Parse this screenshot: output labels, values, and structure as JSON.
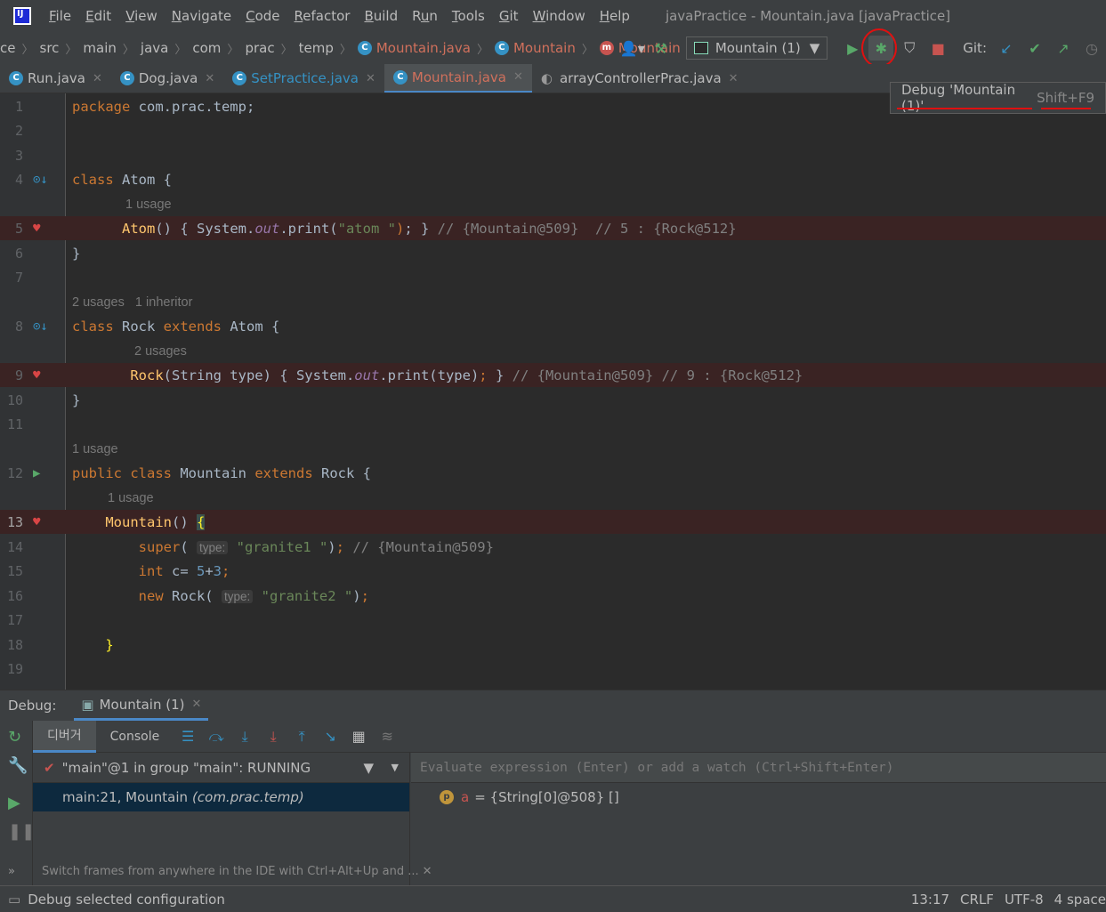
{
  "menubar": {
    "items": [
      {
        "pre": "",
        "u": "F",
        "post": "ile"
      },
      {
        "pre": "",
        "u": "E",
        "post": "dit"
      },
      {
        "pre": "",
        "u": "V",
        "post": "iew"
      },
      {
        "pre": "",
        "u": "N",
        "post": "avigate"
      },
      {
        "pre": "",
        "u": "C",
        "post": "ode"
      },
      {
        "pre": "",
        "u": "R",
        "post": "efactor"
      },
      {
        "pre": "",
        "u": "B",
        "post": "uild"
      },
      {
        "pre": "R",
        "u": "u",
        "post": "n"
      },
      {
        "pre": "",
        "u": "T",
        "post": "ools"
      },
      {
        "pre": "",
        "u": "G",
        "post": "it"
      },
      {
        "pre": "",
        "u": "W",
        "post": "indow"
      },
      {
        "pre": "",
        "u": "H",
        "post": "elp"
      }
    ],
    "window_title": "javaPractice - Mountain.java [javaPractice]"
  },
  "breadcrumb": [
    "ce",
    "src",
    "main",
    "java",
    "com",
    "prac",
    "temp"
  ],
  "breadcrumb_file": "Mountain.java",
  "breadcrumb_class": "Mountain",
  "breadcrumb_method": "Mountain",
  "run_config": "Mountain (1)",
  "git_label": "Git:",
  "tabs": [
    "Run.java",
    "Dog.java",
    "SetPractice.java",
    "Mountain.java",
    "arrayControllerPrac.java"
  ],
  "tooltip": {
    "label": "Debug 'Mountain (1)'",
    "shortcut": "Shift+F9"
  },
  "code": {
    "pkg": "com.prac.temp;",
    "usage1": "1 usage",
    "usage2": "2 usages   1 inheritor",
    "usage3": "2 usages",
    "usage4": "1 usage",
    "usage5": "1 usage",
    "l5": "// {Mountain@509}  // 5 : {Rock@512}",
    "l9": "// {Mountain@509} // 9 : {Rock@512}",
    "l14": "// {Mountain@509}",
    "hint_type": "type:",
    "s_atom": "\"atom \"",
    "s_g1": "\"granite1 \"",
    "s_g2": "\"granite2 \"",
    "n5": "5",
    "n3": "3"
  },
  "debug": {
    "title": "Debug:",
    "session": "Mountain (1)",
    "tab_debugger": "디버거",
    "tab_console": "Console",
    "thread": "\"main\"@1 in group \"main\": RUNNING",
    "frame": "main:21, Mountain",
    "frame_pkg": "(com.prac.temp)",
    "switch_hint": "Switch frames from anywhere in the IDE with Ctrl+Alt+Up and ...",
    "eval_placeholder": "Evaluate expression (Enter) or add a watch (Ctrl+Shift+Enter)",
    "var_name": "a",
    "var_value": "= {String[0]@508} []"
  },
  "status": {
    "message": "Debug selected configuration",
    "position": "13:17",
    "line_sep": "CRLF",
    "encoding": "UTF-8",
    "indent": "4 space"
  },
  "colors": {
    "accent": "#4a88c7",
    "breakpoint": "#d84545",
    "annotation_red": "#e01010"
  },
  "icons": [
    "app-logo-icon",
    "class-icon",
    "method-icon",
    "bug-icon",
    "run-icon",
    "stop-icon",
    "hammer-icon",
    "breakpoint-icon",
    "filter-icon",
    "resume-icon",
    "pause-icon",
    "rerun-icon",
    "wrench-icon"
  ]
}
